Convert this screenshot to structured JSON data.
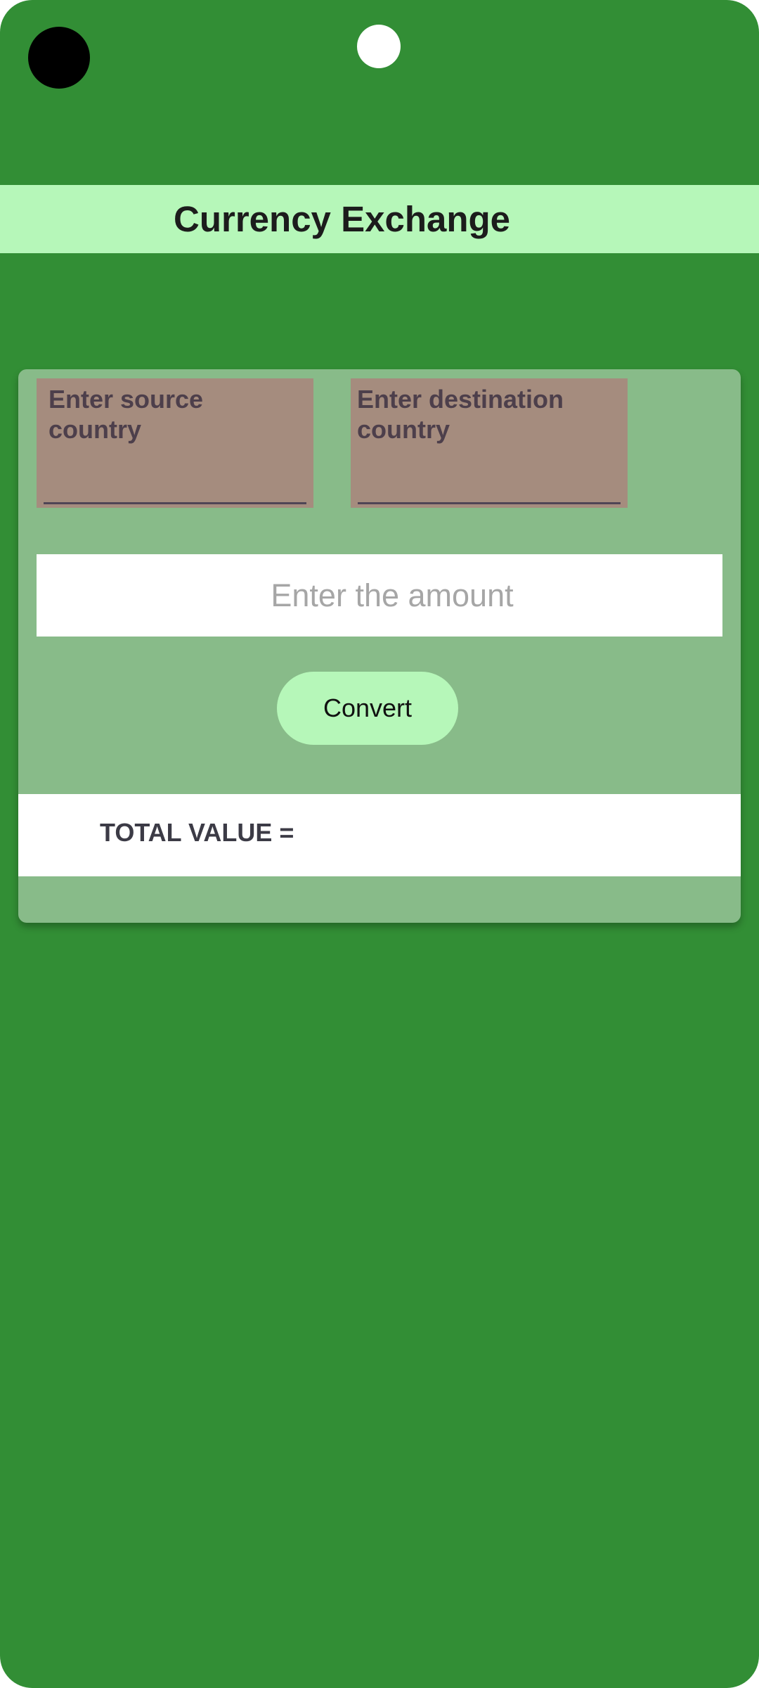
{
  "colors": {
    "background": "#328e35",
    "app_bar": "#b6f7b9",
    "card": "#88bb89",
    "country_field": "#a58c7e",
    "button": "#b6f7b9"
  },
  "app_bar": {
    "title": "Currency Exchange"
  },
  "form": {
    "source_country_label": "Enter source\ncountry",
    "destination_country_label": "Enter destination\n country",
    "amount_placeholder": "Enter the amount",
    "amount_value": "",
    "convert_label": "Convert"
  },
  "result": {
    "label": "TOTAL VALUE =",
    "value": ""
  }
}
